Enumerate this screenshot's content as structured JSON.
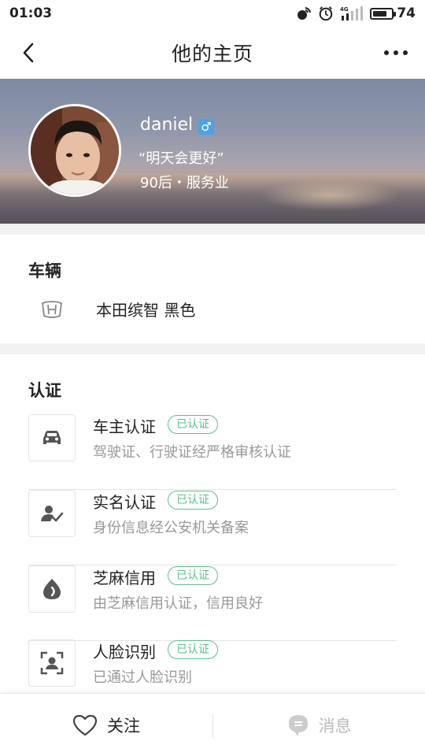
{
  "status_bar": {
    "time": "01:03",
    "network": "4G",
    "battery_level": "74"
  },
  "nav": {
    "title": "他的主页"
  },
  "profile": {
    "nickname": "daniel",
    "gender_symbol": "♂",
    "signature": "“明天会更好”",
    "tags": "90后・服务业"
  },
  "vehicle": {
    "section_title": "车辆",
    "description": "本田缤智 黑色",
    "brand_icon": "honda-logo-icon"
  },
  "certification": {
    "section_title": "认证",
    "items": [
      {
        "name": "车主认证",
        "badge": "已认证",
        "desc": "驾驶证、行驶证经严格审核认证",
        "icon": "car-icon"
      },
      {
        "name": "实名认证",
        "badge": "已认证",
        "desc": "身份信息经公安机关备案",
        "icon": "user-check-icon"
      },
      {
        "name": "芝麻信用",
        "badge": "已认证",
        "desc": "由芝麻信用认证，信用良好",
        "icon": "sesame-credit-icon"
      },
      {
        "name": "人脸识别",
        "badge": "已认证",
        "desc": "已通过人脸识别",
        "icon": "face-scan-icon"
      }
    ]
  },
  "bottom_bar": {
    "follow_label": "关注",
    "message_label": "消息"
  },
  "colors": {
    "badge_green": "#5bbf8b",
    "gender_blue": "#4aa3e8",
    "muted_gray": "#999999"
  }
}
